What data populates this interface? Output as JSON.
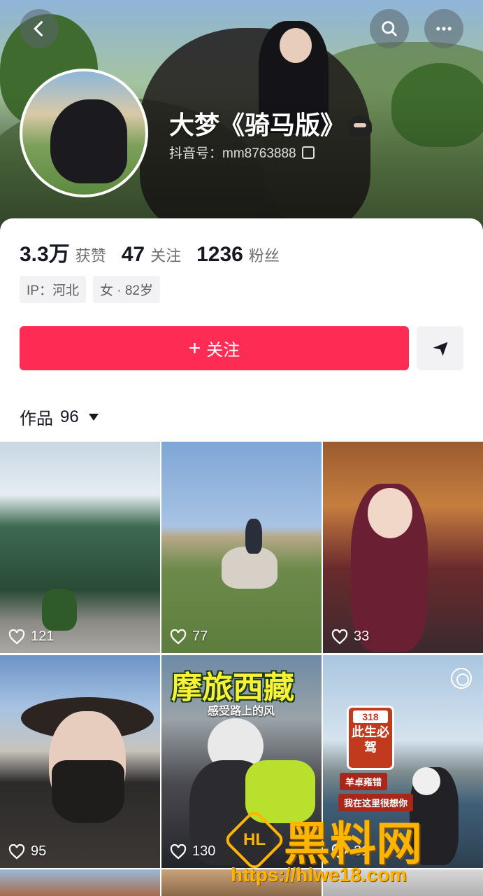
{
  "profile": {
    "name": "大梦《骑马版》",
    "handle": "抖音号：mm8763888"
  },
  "stats": [
    {
      "value": "3.3万",
      "label": "获赞"
    },
    {
      "value": "47",
      "label": "关注"
    },
    {
      "value": "1236",
      "label": "粉丝"
    }
  ],
  "tags": [
    "IP：河北",
    "女 · 82岁"
  ],
  "actions": {
    "follow_label": "关注",
    "follow_plus": "+"
  },
  "works": {
    "label": "作品",
    "count": "96"
  },
  "videos": [
    {
      "likes": "121"
    },
    {
      "likes": "77"
    },
    {
      "likes": "33"
    },
    {
      "likes": "95"
    },
    {
      "likes": "130",
      "overlay_title": "摩旅西藏",
      "overlay_sub": "感受路上的风"
    },
    {
      "likes": "31",
      "sign_num": "318",
      "sign_text": "此生必驾",
      "banner1": "羊卓雍错",
      "banner2": "我在这里很想你"
    }
  ],
  "watermark": {
    "logo_text": "HL",
    "text": "黑料网",
    "url": "https://hlwe18.com"
  },
  "colors": {
    "accent": "#fe2c55",
    "watermark": "#ffb400"
  }
}
